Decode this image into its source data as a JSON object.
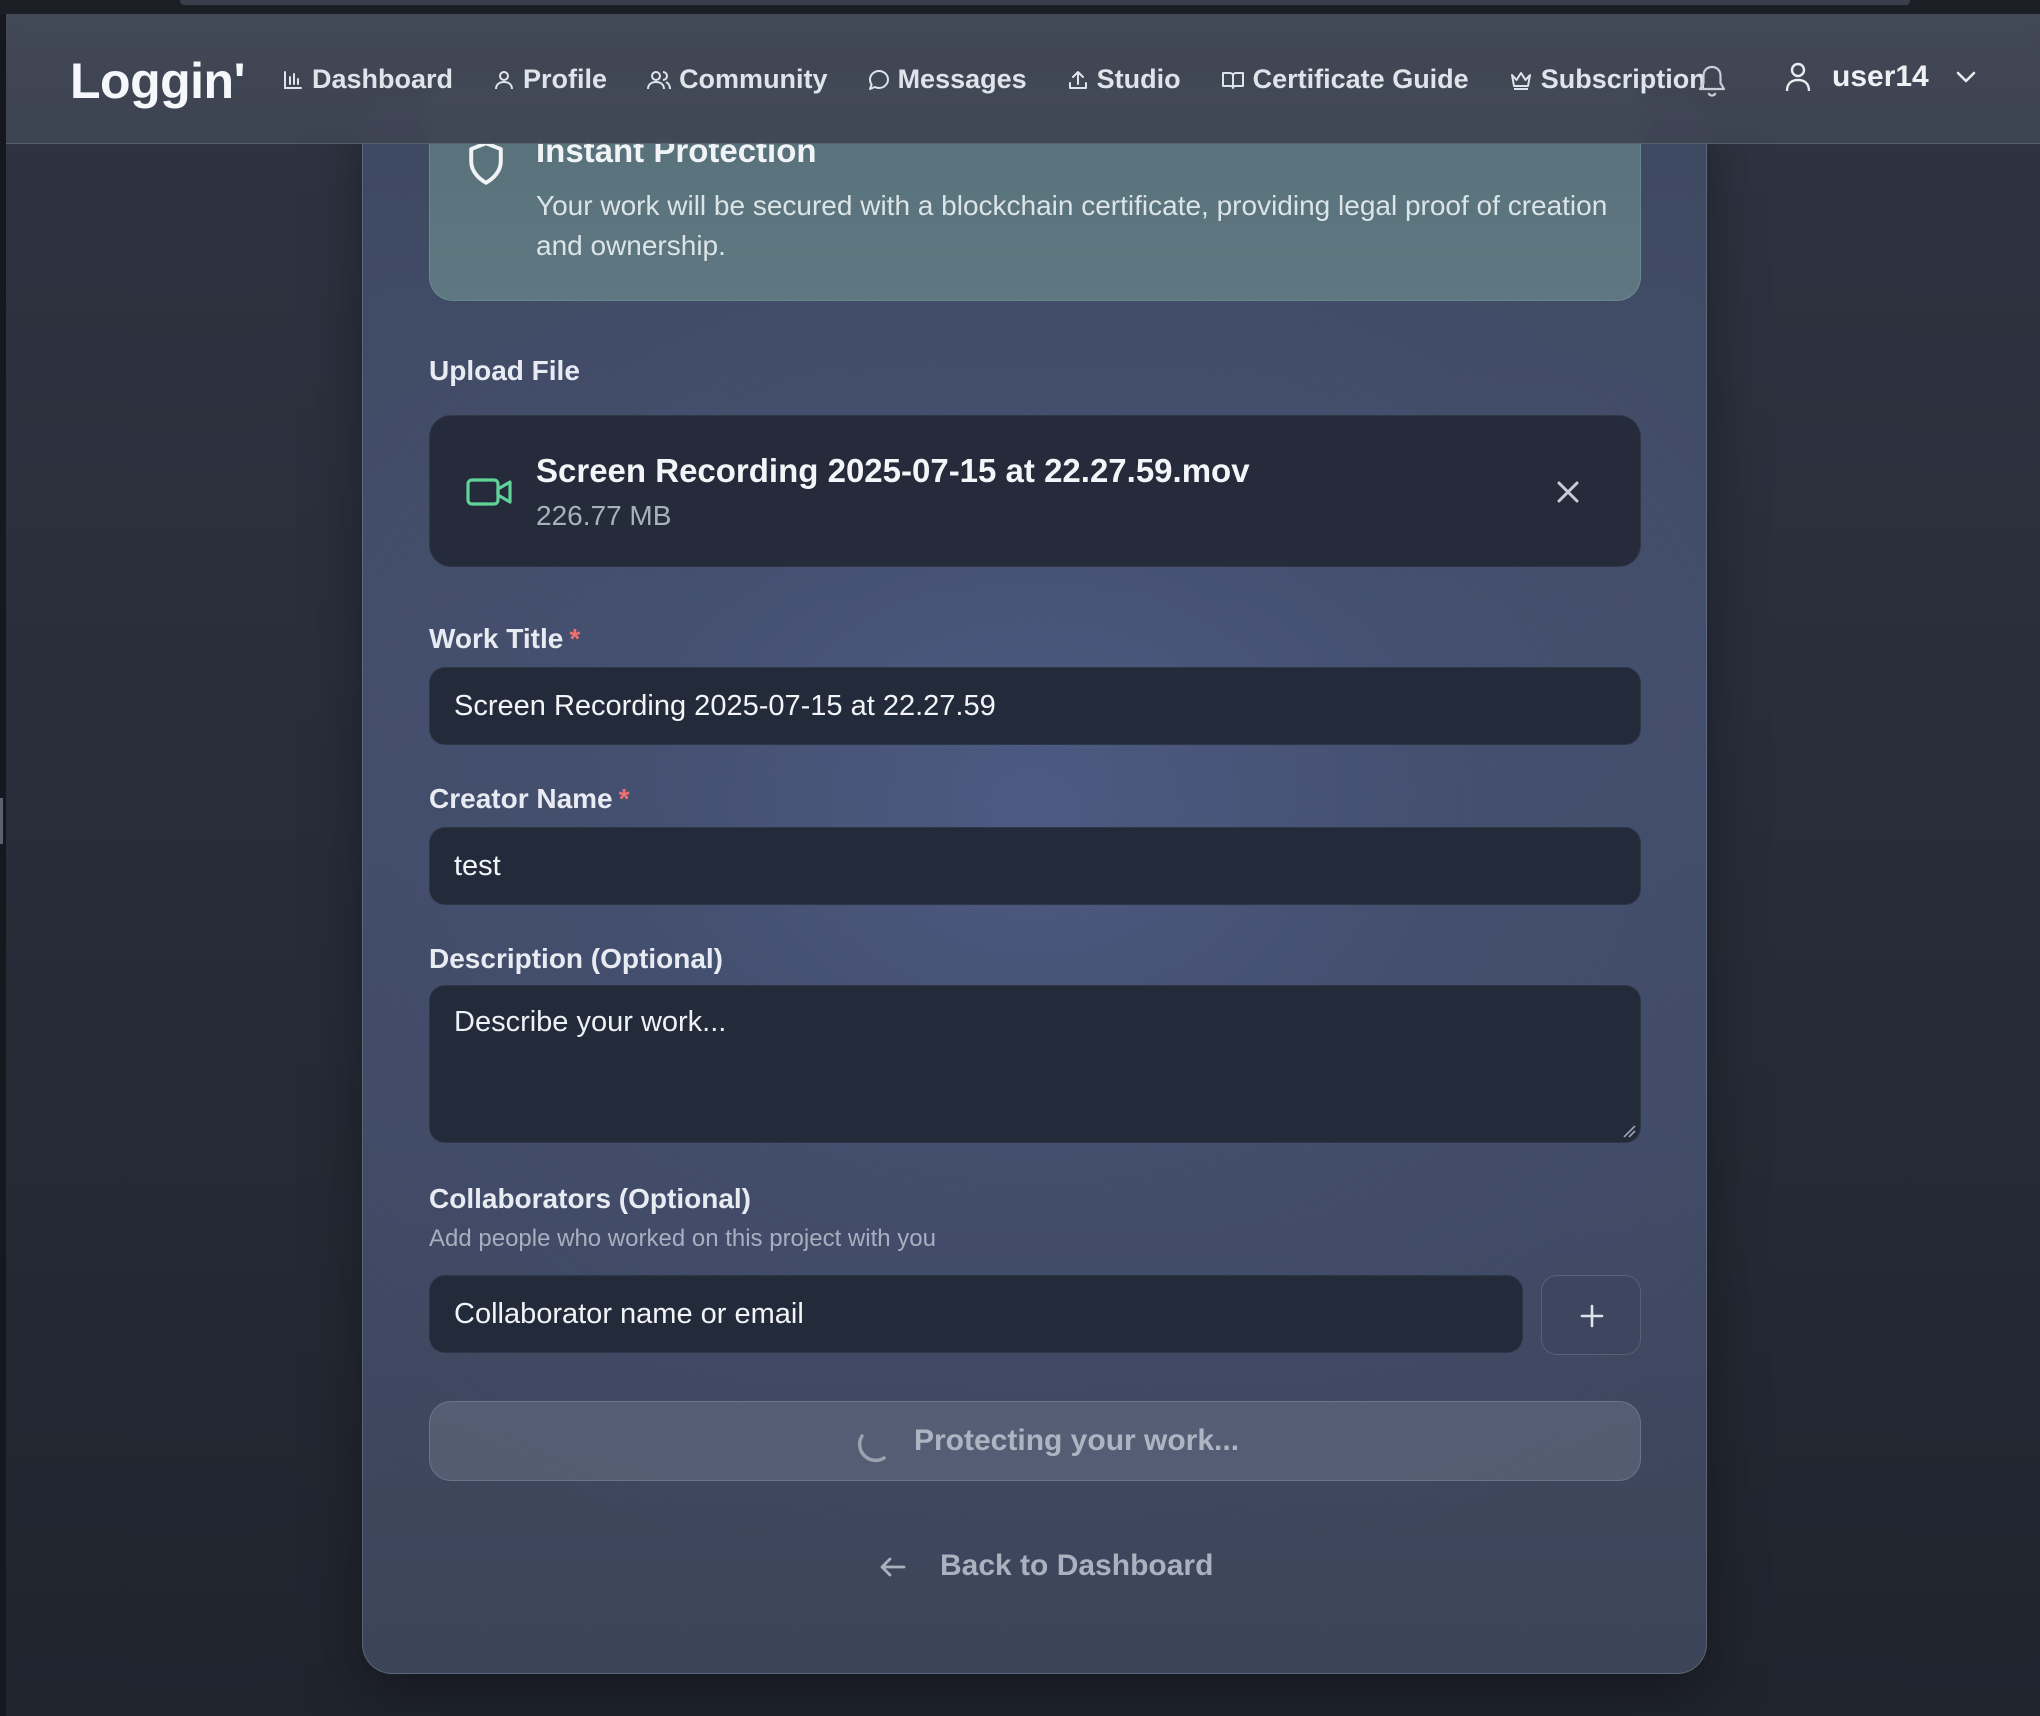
{
  "header": {
    "logo": "Loggin'",
    "nav": [
      {
        "label": "Dashboard",
        "icon": "bar-chart-icon"
      },
      {
        "label": "Profile",
        "icon": "user-icon"
      },
      {
        "label": "Community",
        "icon": "users-icon"
      },
      {
        "label": "Messages",
        "icon": "message-circle-icon"
      },
      {
        "label": "Studio",
        "icon": "upload-icon"
      },
      {
        "label": "Certificate Guide",
        "icon": "book-open-icon"
      },
      {
        "label": "Subscription",
        "icon": "crown-icon"
      }
    ],
    "username": "user14"
  },
  "protection": {
    "title": "Instant Protection",
    "description": "Your work will be secured with a blockchain certificate, providing legal proof of creation and ownership."
  },
  "upload": {
    "label": "Upload File",
    "file_name": "Screen Recording 2025-07-15 at 22.27.59.mov",
    "file_size": "226.77 MB"
  },
  "form": {
    "title_label": "Work Title",
    "title_value": "Screen Recording 2025-07-15 at 22.27.59",
    "creator_label": "Creator Name",
    "creator_value": "test",
    "required_mark": "*",
    "description_label": "Description (Optional)",
    "description_placeholder": "Describe your work...",
    "collaborators_label": "Collaborators (Optional)",
    "collaborators_hint": "Add people who worked on this project with you",
    "collaborator_placeholder": "Collaborator name or email"
  },
  "submit": {
    "label": "Protecting your work..."
  },
  "back": {
    "label": "Back to Dashboard"
  },
  "colors": {
    "accent_green": "#5fd39a",
    "required": "#f07171"
  }
}
